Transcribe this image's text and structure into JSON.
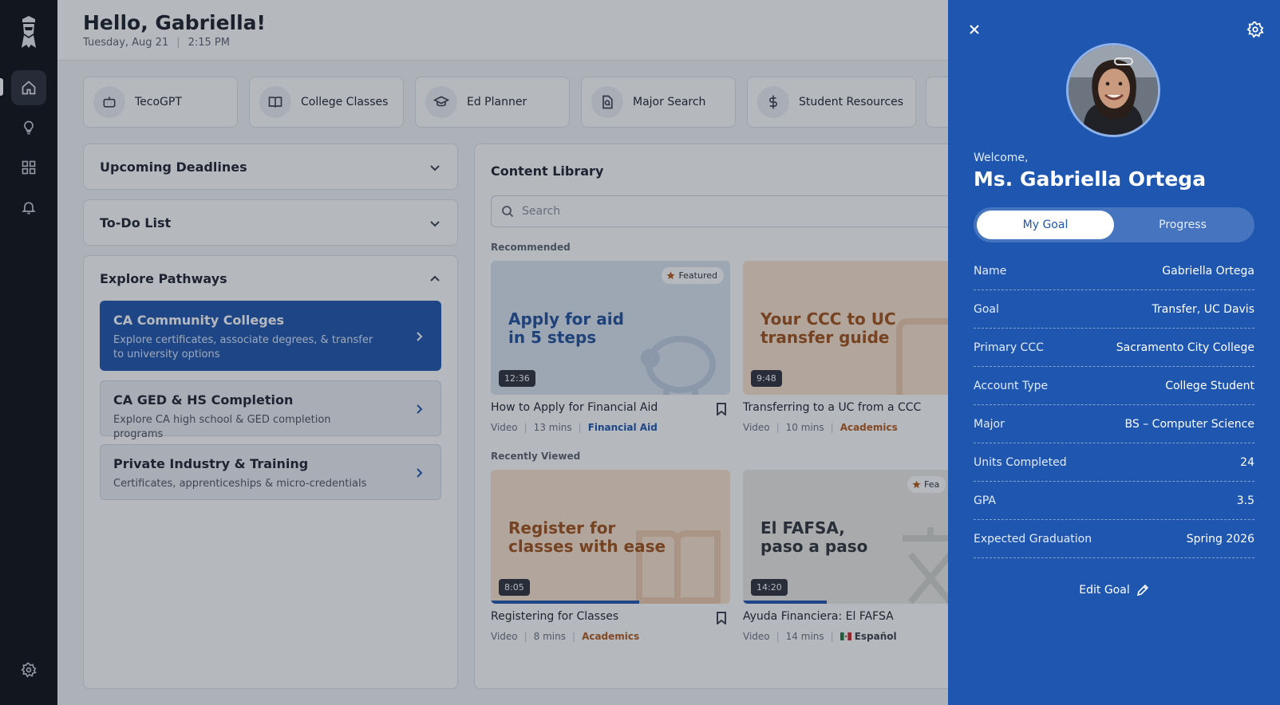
{
  "header": {
    "greeting": "Hello, Gabriella!",
    "date": "Tuesday, Aug 21",
    "time": "2:15 PM"
  },
  "rail": {
    "items": [
      "home-icon",
      "lightbulb-icon",
      "grid-icon",
      "bell-icon"
    ],
    "bottom": "gear-icon"
  },
  "quick_links": [
    {
      "label": "TecoGPT",
      "icon": "robot-icon"
    },
    {
      "label": "College Classes",
      "icon": "book-icon"
    },
    {
      "label": "Ed Planner",
      "icon": "graduation-cap-icon"
    },
    {
      "label": "Major Search",
      "icon": "document-search-icon"
    },
    {
      "label": "Student Resources",
      "icon": "dollar-icon"
    }
  ],
  "accordions": {
    "deadlines": "Upcoming Deadlines",
    "todo": "To-Do List",
    "pathways": "Explore Pathways"
  },
  "pathways": [
    {
      "title": "CA Community Colleges",
      "subtitle": "Explore certificates, associate degrees, & transfer to university options"
    },
    {
      "title": "CA GED & HS Completion",
      "subtitle": "Explore CA high school & GED completion programs"
    },
    {
      "title": "Private Industry & Training",
      "subtitle": "Certificates, apprenticeships & micro-credentials"
    }
  ],
  "library": {
    "title": "Content Library",
    "search_placeholder": "Search",
    "recommended_label": "Recommended",
    "recent_label": "Recently Viewed",
    "featured_label": "Featured",
    "featured_label_clipped": "Fea",
    "recommended": [
      {
        "thumb_text_1": "Apply for aid",
        "thumb_text_2": "in 5 steps",
        "duration": "12:36",
        "featured": true,
        "title": "How to Apply for Financial Aid",
        "type": "Video",
        "length": "13 mins",
        "tag": "Financial Aid",
        "tag_color": "#1e56b0",
        "bg": "#dbe6f4",
        "text_color": "#1e4f9c"
      },
      {
        "thumb_text_1": "Your CCC to UC",
        "thumb_text_2": "transfer guide",
        "duration": "9:48",
        "featured": false,
        "title": "Transferring to a UC from a CCC",
        "type": "Video",
        "length": "10 mins",
        "tag": "Academics",
        "tag_color": "#b45a1e",
        "bg": "#fbe3d0",
        "text_color": "#a2511a"
      }
    ],
    "recent": [
      {
        "thumb_text_1": "Register for",
        "thumb_text_2": "classes with ease",
        "duration": "8:05",
        "progress": 0.62,
        "title": "Registering for Classes",
        "type": "Video",
        "length": "8 mins",
        "tag": "Academics",
        "tag_color": "#b45a1e",
        "bg": "#fbe3d0",
        "text_color": "#a2511a"
      },
      {
        "thumb_text_1": "El FAFSA,",
        "thumb_text_2": "paso a paso",
        "duration": "14:20",
        "progress": 0.35,
        "title": "Ayuda Financiera: El FAFSA",
        "type": "Video",
        "length": "14 mins",
        "tag": "Español",
        "tag_color": "#3a3f4a",
        "bg": "#ecebe7",
        "text_color": "#2f333b"
      }
    ]
  },
  "profile": {
    "welcome": "Welcome,",
    "name": "Ms. Gabriella Ortega",
    "tab_active": "My Goal",
    "tab_inactive": "Progress",
    "rows": [
      {
        "key": "Name",
        "value": "Gabriella Ortega"
      },
      {
        "key": "Goal",
        "value": "Transfer, UC Davis"
      },
      {
        "key": "Primary CCC",
        "value": "Sacramento City College"
      },
      {
        "key": "Account Type",
        "value": "College Student"
      },
      {
        "key": "Major",
        "value": "BS – Computer Science"
      },
      {
        "key": "Units Completed",
        "value": "24"
      },
      {
        "key": "GPA",
        "value": "3.5"
      },
      {
        "key": "Expected Graduation",
        "value": "Spring 2026"
      }
    ],
    "edit_label": "Edit Goal"
  },
  "colors": {
    "accent": "#1e56b0",
    "rail": "#0c0f16"
  }
}
